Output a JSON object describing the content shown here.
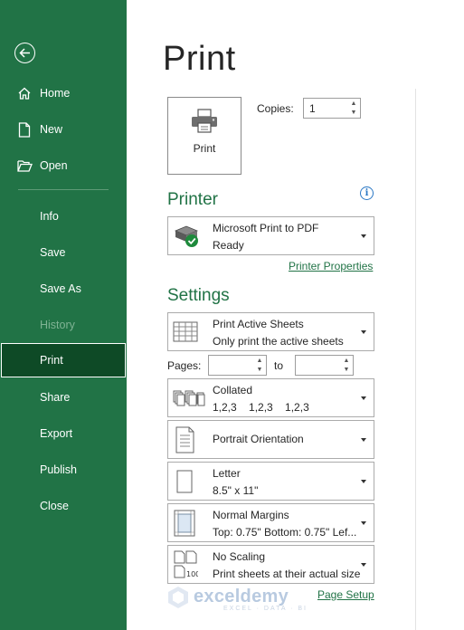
{
  "sidebar": {
    "items": [
      {
        "label": "Home"
      },
      {
        "label": "New"
      },
      {
        "label": "Open"
      },
      {
        "label": "Info"
      },
      {
        "label": "Save"
      },
      {
        "label": "Save As"
      },
      {
        "label": "History"
      },
      {
        "label": "Print"
      },
      {
        "label": "Share"
      },
      {
        "label": "Export"
      },
      {
        "label": "Publish"
      },
      {
        "label": "Close"
      }
    ],
    "selected": "Print",
    "colors": {
      "background": "#217346",
      "selected": "#0e4a26"
    }
  },
  "main": {
    "title": "Print",
    "print_button_label": "Print",
    "copies_label": "Copies:",
    "copies_value": "1",
    "printer_section": "Printer",
    "printer": {
      "name": "Microsoft Print to PDF",
      "status": "Ready"
    },
    "printer_properties_link": "Printer Properties",
    "settings_section": "Settings",
    "settings": {
      "sheets": {
        "title": "Print Active Sheets",
        "subtitle": "Only print the active sheets"
      },
      "pages_label": "Pages:",
      "to_label": "to",
      "pages_from": "",
      "pages_to": "",
      "collation": {
        "title": "Collated",
        "subtitle": "1,2,3    1,2,3    1,2,3"
      },
      "orientation": {
        "title": "Portrait Orientation"
      },
      "paper": {
        "title": "Letter",
        "subtitle": "8.5\" x 11\""
      },
      "margins": {
        "title": "Normal Margins",
        "subtitle": "Top: 0.75\" Bottom: 0.75\" Lef..."
      },
      "scaling": {
        "title": "No Scaling",
        "subtitle": "Print sheets at their actual size"
      }
    },
    "page_setup_link": "Page Setup",
    "accent_color": "#217346"
  },
  "watermark": {
    "name": "exceldemy",
    "tagline": "EXCEL · DATA · BI"
  }
}
